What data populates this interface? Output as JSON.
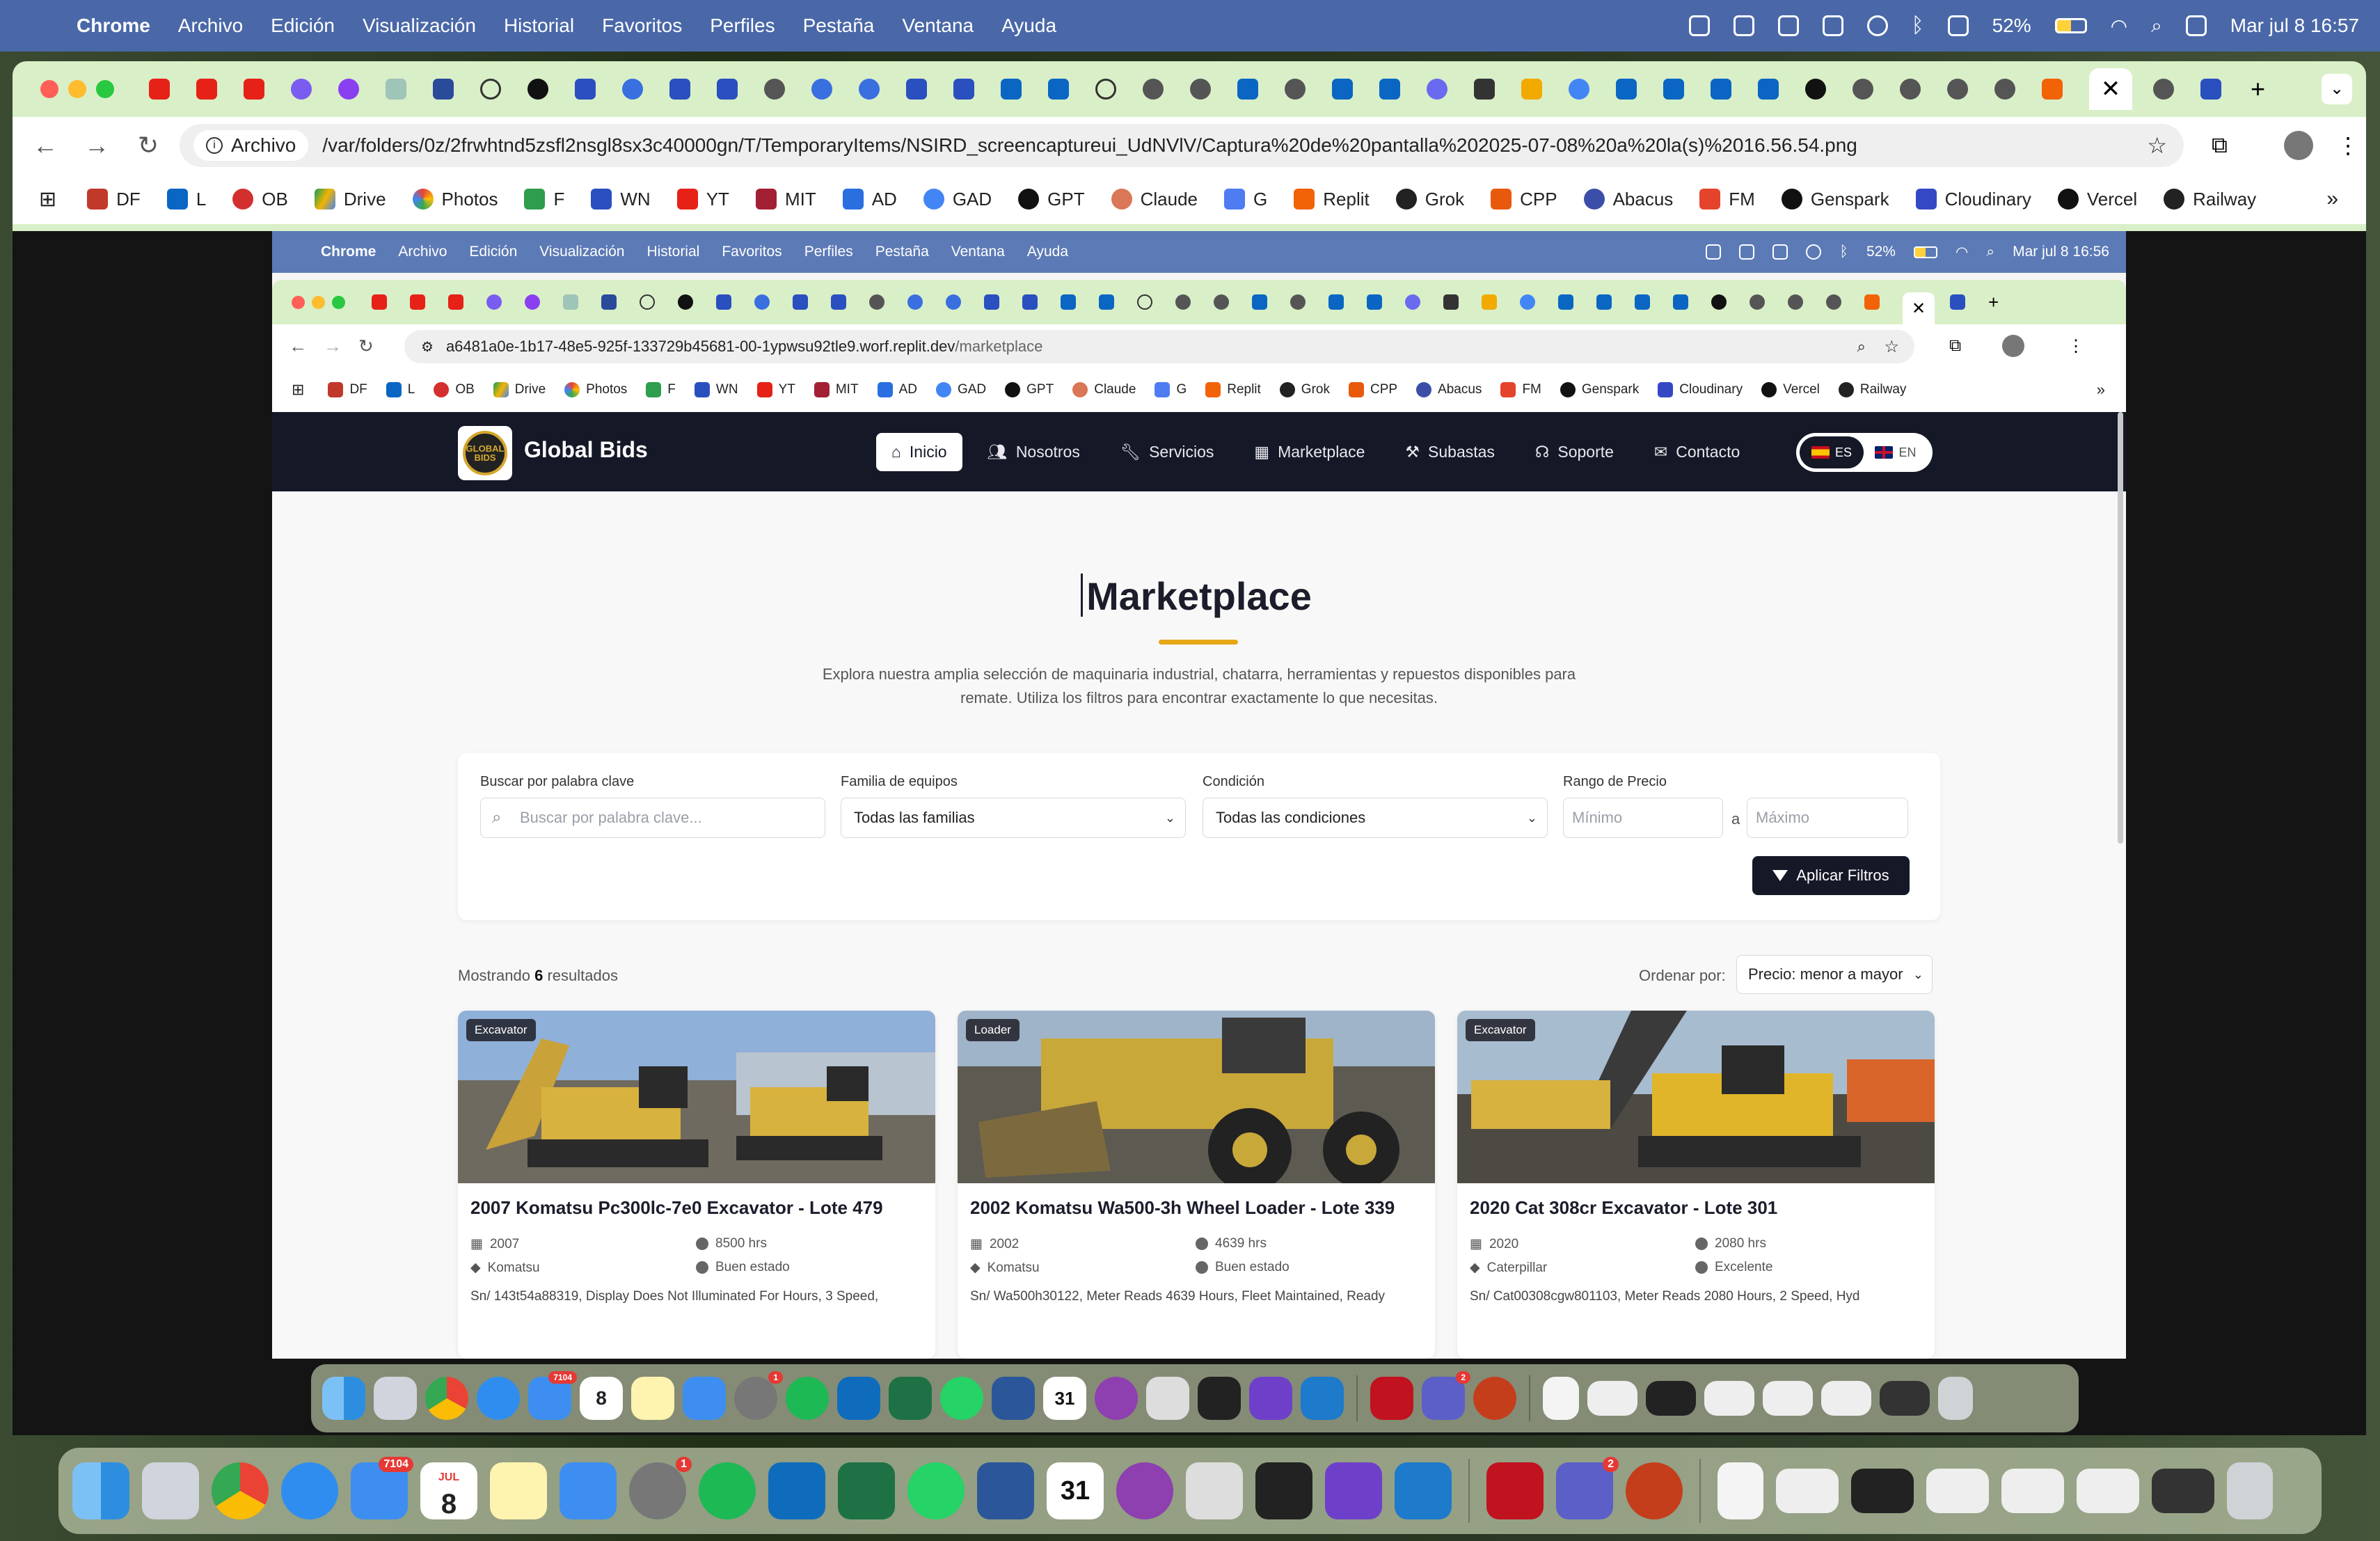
{
  "os_menubar": {
    "app": "Chrome",
    "items": [
      "Archivo",
      "Edición",
      "Visualización",
      "Historial",
      "Favoritos",
      "Perfiles",
      "Pestaña",
      "Ventana",
      "Ayuda"
    ],
    "battery": "52%",
    "datetime": "Mar jul 8  16:57"
  },
  "browser": {
    "chip_label": "Archivo",
    "url": "/var/folders/0z/2frwhtnd5zsfl2nsgl8sx3c40000gn/T/TemporaryItems/NSIRD_screencaptureui_UdNVlV/Captura%20de%20pantalla%202025-07-08%20a%20la(s)%2016.56.54.png",
    "tab_close": "✕",
    "new_tab": "+",
    "bookmarks": [
      "DF",
      "L",
      "OB",
      "Drive",
      "Photos",
      "F",
      "WN",
      "YT",
      "MIT",
      "AD",
      "GAD",
      "GPT",
      "Claude",
      "G",
      "Replit",
      "Grok",
      "CPP",
      "Abacus",
      "FM",
      "Genspark",
      "Cloudinary",
      "Vercel",
      "Railway"
    ]
  },
  "inner": {
    "menubar": {
      "app": "Chrome",
      "items": [
        "Archivo",
        "Edición",
        "Visualización",
        "Historial",
        "Favoritos",
        "Perfiles",
        "Pestaña",
        "Ventana",
        "Ayuda"
      ],
      "battery": "52%",
      "datetime": "Mar jul 8  16:56"
    },
    "url_host": "a6481a0e-1b17-48e5-925f-133729b45681-00-1ypwsu92tle9.worf.replit.dev",
    "url_path": "/marketplace",
    "bookmarks": [
      "DF",
      "L",
      "OB",
      "Drive",
      "Photos",
      "F",
      "WN",
      "YT",
      "MIT",
      "AD",
      "GAD",
      "GPT",
      "Claude",
      "G",
      "Replit",
      "Grok",
      "CPP",
      "Abacus",
      "FM",
      "Genspark",
      "Cloudinary",
      "Vercel",
      "Railway"
    ]
  },
  "site": {
    "brand": "Global Bids",
    "logo_text": "GLOBAL BIDS",
    "nav": [
      {
        "label": "Inicio",
        "icon": "home-icon"
      },
      {
        "label": "Nosotros",
        "icon": "users-icon"
      },
      {
        "label": "Servicios",
        "icon": "wrench-icon"
      },
      {
        "label": "Marketplace",
        "icon": "grid-icon"
      },
      {
        "label": "Subastas",
        "icon": "gavel-icon"
      },
      {
        "label": "Soporte",
        "icon": "headset-icon"
      },
      {
        "label": "Contacto",
        "icon": "envelope-icon"
      }
    ],
    "lang": {
      "es": "ES",
      "en": "EN"
    },
    "page_title": "Marketplace",
    "page_desc": "Explora nuestra amplia selección de maquinaria industrial, chatarra, herramientas y repuestos disponibles para remate. Utiliza los filtros para encontrar exactamente lo que necesitas.",
    "filters": {
      "keyword_label": "Buscar por palabra clave",
      "keyword_placeholder": "Buscar por palabra clave...",
      "family_label": "Familia de equipos",
      "family_value": "Todas las familias",
      "condition_label": "Condición",
      "condition_value": "Todas las condiciones",
      "price_label": "Rango de Precio",
      "min_placeholder": "Mínimo",
      "range_sep": "a",
      "max_placeholder": "Máximo",
      "apply_label": "Aplicar Filtros"
    },
    "results_prefix": "Mostrando",
    "results_count": "6",
    "results_suffix": "resultados",
    "sort_label": "Ordenar por:",
    "sort_value": "Precio: menor a mayor",
    "cards": [
      {
        "badge": "Excavator",
        "title": "2007 Komatsu Pc300lc-7e0 Excavator - Lote 479",
        "year": "2007",
        "hours": "8500 hrs",
        "brand": "Komatsu",
        "condition": "Buen estado",
        "desc": "Sn/ 143t54a88319, Display Does Not Illuminated For Hours, 3 Speed,"
      },
      {
        "badge": "Loader",
        "title": "2002 Komatsu Wa500-3h Wheel Loader - Lote 339",
        "year": "2002",
        "hours": "4639 hrs",
        "brand": "Komatsu",
        "condition": "Buen estado",
        "desc": "Sn/ Wa500h30122, Meter Reads 4639 Hours, Fleet Maintained, Ready"
      },
      {
        "badge": "Excavator",
        "title": "2020 Cat 308cr Excavator - Lote 301",
        "year": "2020",
        "hours": "2080 hrs",
        "brand": "Caterpillar",
        "condition": "Excelente",
        "desc": "Sn/ Cat00308cgw801103, Meter Reads 2080 Hours, 2 Speed, Hyd"
      }
    ]
  },
  "dock": {
    "mail_badge": "7104",
    "calendar_month": "JUL",
    "calendar_day": "8",
    "settings_badge": "1",
    "teams_badge": "2",
    "calendar31": "31"
  }
}
